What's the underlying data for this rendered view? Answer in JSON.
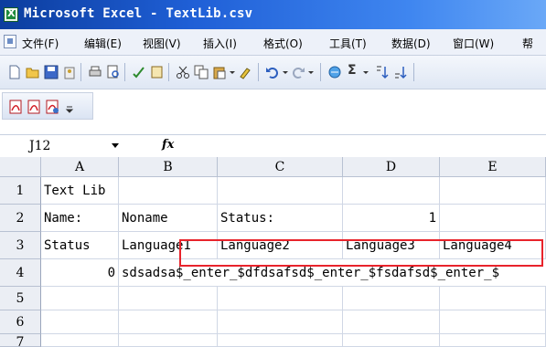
{
  "window": {
    "title": "Microsoft Excel - TextLib.csv"
  },
  "menu": [
    "文件(F)",
    "编辑(E)",
    "视图(V)",
    "插入(I)",
    "格式(O)",
    "工具(T)",
    "数据(D)",
    "窗口(W)",
    "帮"
  ],
  "toolbar": {
    "sum_label": "Σ"
  },
  "formula_bar": {
    "name_box": "J12",
    "fx_label": "fx",
    "formula": ""
  },
  "sheet": {
    "columns": [
      "A",
      "B",
      "C",
      "D",
      "E"
    ],
    "rows": [
      "1",
      "2",
      "3",
      "4",
      "5",
      "6",
      "7"
    ],
    "cells": {
      "A1": "Text Lib",
      "A2": "Name:",
      "B2": "Noname",
      "C2": "Status:",
      "D2": "1",
      "A3": "Status",
      "B3": "Language1",
      "C3": "Language2",
      "D3": "Language3",
      "E3": "Language4",
      "A4": "0",
      "B4": "sdsadsa$_enter_$dfdsafsd$_enter_$fsdafsd$_enter_$"
    }
  },
  "colors": {
    "highlight": "#e8232b",
    "titlebar": "#1f5fd6"
  }
}
